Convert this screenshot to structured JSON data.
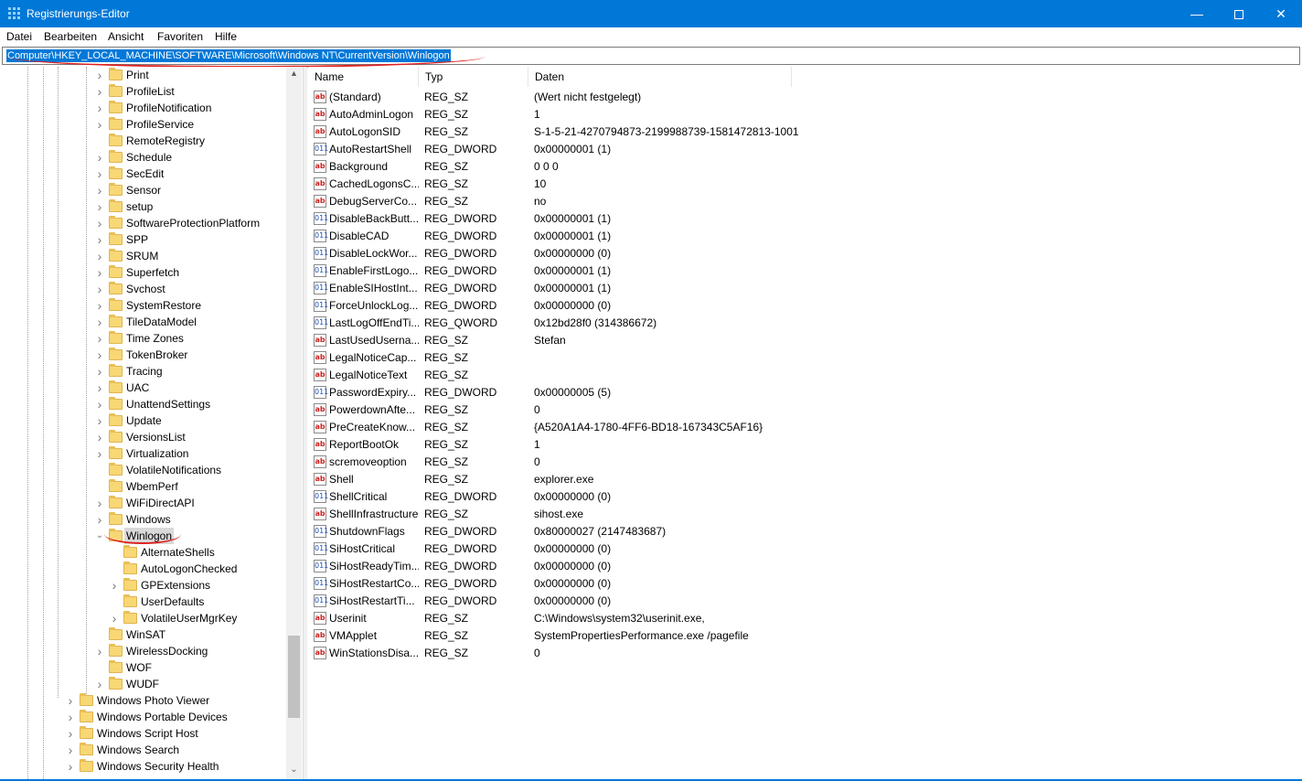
{
  "window": {
    "title": "Registrierungs-Editor",
    "minimize_glyph": "—",
    "close_glyph": "✕"
  },
  "menu": [
    "Datei",
    "Bearbeiten",
    "Ansicht",
    "Favoriten",
    "Hilfe"
  ],
  "address": {
    "path": "Computer\\HKEY_LOCAL_MACHINE\\SOFTWARE\\Microsoft\\Windows NT\\CurrentVersion\\Winlogon"
  },
  "colors": {
    "accent": "#0078d7",
    "annotation": "#e0201e",
    "folder": "#f8d775"
  },
  "tree": [
    {
      "label": "Print",
      "level": 2,
      "expandable": true
    },
    {
      "label": "ProfileList",
      "level": 2,
      "expandable": true
    },
    {
      "label": "ProfileNotification",
      "level": 2,
      "expandable": true
    },
    {
      "label": "ProfileService",
      "level": 2,
      "expandable": true
    },
    {
      "label": "RemoteRegistry",
      "level": 2,
      "expandable": false
    },
    {
      "label": "Schedule",
      "level": 2,
      "expandable": true
    },
    {
      "label": "SecEdit",
      "level": 2,
      "expandable": true
    },
    {
      "label": "Sensor",
      "level": 2,
      "expandable": true
    },
    {
      "label": "setup",
      "level": 2,
      "expandable": true
    },
    {
      "label": "SoftwareProtectionPlatform",
      "level": 2,
      "expandable": true
    },
    {
      "label": "SPP",
      "level": 2,
      "expandable": true
    },
    {
      "label": "SRUM",
      "level": 2,
      "expandable": true
    },
    {
      "label": "Superfetch",
      "level": 2,
      "expandable": true
    },
    {
      "label": "Svchost",
      "level": 2,
      "expandable": true
    },
    {
      "label": "SystemRestore",
      "level": 2,
      "expandable": true
    },
    {
      "label": "TileDataModel",
      "level": 2,
      "expandable": true
    },
    {
      "label": "Time Zones",
      "level": 2,
      "expandable": true
    },
    {
      "label": "TokenBroker",
      "level": 2,
      "expandable": true
    },
    {
      "label": "Tracing",
      "level": 2,
      "expandable": true
    },
    {
      "label": "UAC",
      "level": 2,
      "expandable": true
    },
    {
      "label": "UnattendSettings",
      "level": 2,
      "expandable": true
    },
    {
      "label": "Update",
      "level": 2,
      "expandable": true
    },
    {
      "label": "VersionsList",
      "level": 2,
      "expandable": true
    },
    {
      "label": "Virtualization",
      "level": 2,
      "expandable": true
    },
    {
      "label": "VolatileNotifications",
      "level": 2,
      "expandable": false
    },
    {
      "label": "WbemPerf",
      "level": 2,
      "expandable": false
    },
    {
      "label": "WiFiDirectAPI",
      "level": 2,
      "expandable": true
    },
    {
      "label": "Windows",
      "level": 2,
      "expandable": true
    },
    {
      "label": "Winlogon",
      "level": 2,
      "expandable": true,
      "expanded": true,
      "selected": true
    },
    {
      "label": "AlternateShells",
      "level": 3,
      "expandable": false
    },
    {
      "label": "AutoLogonChecked",
      "level": 3,
      "expandable": false
    },
    {
      "label": "GPExtensions",
      "level": 3,
      "expandable": true
    },
    {
      "label": "UserDefaults",
      "level": 3,
      "expandable": false
    },
    {
      "label": "VolatileUserMgrKey",
      "level": 3,
      "expandable": true
    },
    {
      "label": "WinSAT",
      "level": 2,
      "expandable": false
    },
    {
      "label": "WirelessDocking",
      "level": 2,
      "expandable": true
    },
    {
      "label": "WOF",
      "level": 2,
      "expandable": false
    },
    {
      "label": "WUDF",
      "level": 2,
      "expandable": true
    },
    {
      "label": "Windows Photo Viewer",
      "level": 1,
      "expandable": true
    },
    {
      "label": "Windows Portable Devices",
      "level": 1,
      "expandable": true
    },
    {
      "label": "Windows Script Host",
      "level": 1,
      "expandable": true
    },
    {
      "label": "Windows Search",
      "level": 1,
      "expandable": true
    },
    {
      "label": "Windows Security Health",
      "level": 1,
      "expandable": true
    }
  ],
  "list": {
    "columns": [
      "Name",
      "Typ",
      "Daten"
    ],
    "rows": [
      {
        "name": "(Standard)",
        "type": "REG_SZ",
        "data": "(Wert nicht festgelegt)"
      },
      {
        "name": "AutoAdminLogon",
        "type": "REG_SZ",
        "data": "1"
      },
      {
        "name": "AutoLogonSID",
        "type": "REG_SZ",
        "data": "S-1-5-21-4270794873-2199988739-1581472813-1001"
      },
      {
        "name": "AutoRestartShell",
        "type": "REG_DWORD",
        "data": "0x00000001 (1)"
      },
      {
        "name": "Background",
        "type": "REG_SZ",
        "data": "0 0 0"
      },
      {
        "name": "CachedLogonsC...",
        "type": "REG_SZ",
        "data": "10"
      },
      {
        "name": "DebugServerCo...",
        "type": "REG_SZ",
        "data": "no"
      },
      {
        "name": "DisableBackButt...",
        "type": "REG_DWORD",
        "data": "0x00000001 (1)"
      },
      {
        "name": "DisableCAD",
        "type": "REG_DWORD",
        "data": "0x00000001 (1)"
      },
      {
        "name": "DisableLockWor...",
        "type": "REG_DWORD",
        "data": "0x00000000 (0)"
      },
      {
        "name": "EnableFirstLogo...",
        "type": "REG_DWORD",
        "data": "0x00000001 (1)"
      },
      {
        "name": "EnableSIHostInt...",
        "type": "REG_DWORD",
        "data": "0x00000001 (1)"
      },
      {
        "name": "ForceUnlockLog...",
        "type": "REG_DWORD",
        "data": "0x00000000 (0)"
      },
      {
        "name": "LastLogOffEndTi...",
        "type": "REG_QWORD",
        "data": "0x12bd28f0 (314386672)"
      },
      {
        "name": "LastUsedUserna...",
        "type": "REG_SZ",
        "data": "Stefan"
      },
      {
        "name": "LegalNoticeCap...",
        "type": "REG_SZ",
        "data": ""
      },
      {
        "name": "LegalNoticeText",
        "type": "REG_SZ",
        "data": ""
      },
      {
        "name": "PasswordExpiry...",
        "type": "REG_DWORD",
        "data": "0x00000005 (5)"
      },
      {
        "name": "PowerdownAfte...",
        "type": "REG_SZ",
        "data": "0"
      },
      {
        "name": "PreCreateKnow...",
        "type": "REG_SZ",
        "data": "{A520A1A4-1780-4FF6-BD18-167343C5AF16}"
      },
      {
        "name": "ReportBootOk",
        "type": "REG_SZ",
        "data": "1"
      },
      {
        "name": "scremoveoption",
        "type": "REG_SZ",
        "data": "0"
      },
      {
        "name": "Shell",
        "type": "REG_SZ",
        "data": "explorer.exe"
      },
      {
        "name": "ShellCritical",
        "type": "REG_DWORD",
        "data": "0x00000000 (0)"
      },
      {
        "name": "ShellInfrastructure",
        "type": "REG_SZ",
        "data": "sihost.exe"
      },
      {
        "name": "ShutdownFlags",
        "type": "REG_DWORD",
        "data": "0x80000027 (2147483687)"
      },
      {
        "name": "SiHostCritical",
        "type": "REG_DWORD",
        "data": "0x00000000 (0)"
      },
      {
        "name": "SiHostReadyTim...",
        "type": "REG_DWORD",
        "data": "0x00000000 (0)"
      },
      {
        "name": "SiHostRestartCo...",
        "type": "REG_DWORD",
        "data": "0x00000000 (0)"
      },
      {
        "name": "SiHostRestartTi...",
        "type": "REG_DWORD",
        "data": "0x00000000 (0)"
      },
      {
        "name": "Userinit",
        "type": "REG_SZ",
        "data": "C:\\Windows\\system32\\userinit.exe,"
      },
      {
        "name": "VMApplet",
        "type": "REG_SZ",
        "data": "SystemPropertiesPerformance.exe /pagefile"
      },
      {
        "name": "WinStationsDisa...",
        "type": "REG_SZ",
        "data": "0"
      }
    ]
  }
}
